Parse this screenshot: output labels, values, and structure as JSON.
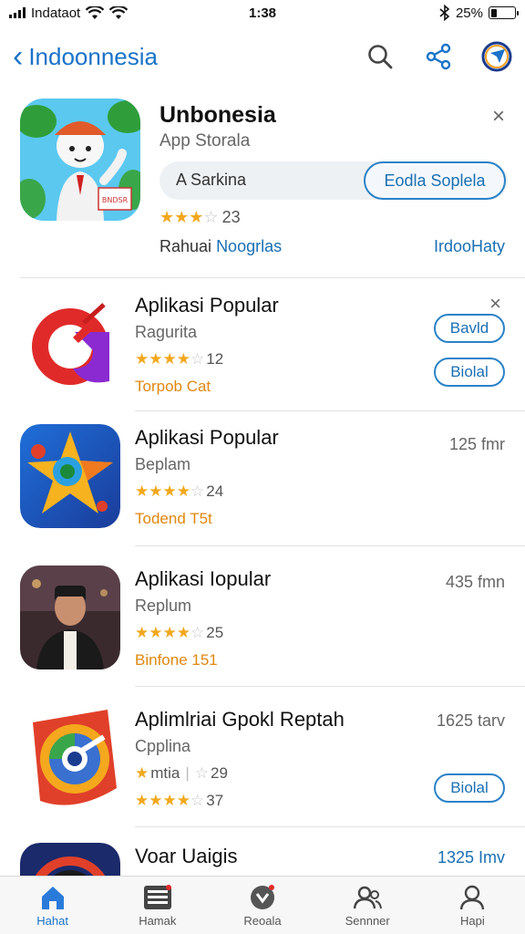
{
  "status_bar": {
    "carrier": "Indataot",
    "time": "1:38",
    "battery": "25%",
    "battery_level": 0.25
  },
  "nav": {
    "back_label": "Indoonnesia"
  },
  "featured": {
    "title": "Unbonesia",
    "subtitle": "App Storala",
    "search_placeholder": "A Sarkina",
    "action_button": "Eodla Soplela",
    "rating_count": "23",
    "rating_stars": 3,
    "left_link_prefix": "Rahuai",
    "left_link_highlight": "Noogrlas",
    "right_link": "IrdooHaty",
    "close_symbol": "×",
    "icon_badge_text": "BNDSR"
  },
  "apps": [
    {
      "name": "Aplikasi Popular",
      "developer": "Ragurita",
      "rating_count": "12",
      "rating_stars": 4,
      "tag": "Torpob Cat",
      "button_primary": "Bavld",
      "button_secondary": "Biolal",
      "close_symbol": "×"
    },
    {
      "name": "Aplikasi Popular",
      "developer": "Beplam",
      "rating_count": "24",
      "rating_stars": 4,
      "tag": "Todend T5t",
      "size": "125 fmr"
    },
    {
      "name": "Aplikasi Iopular",
      "developer": "Replum",
      "rating_count": "25",
      "rating_stars": 4,
      "tag": "Binfone 151",
      "size": "435 fmn"
    },
    {
      "name": "Aplimlriai Gpokl Reptah",
      "developer": "Cpplina",
      "rating_prefix": "mtia",
      "rating_count": "29",
      "rating_count2": "37",
      "rating_stars": 4,
      "size": "1625 tarv",
      "button_primary": "Biolal"
    },
    {
      "name": "Voar Uaigis",
      "size": "1325 Imv"
    }
  ],
  "tabs": [
    {
      "label": "Hahat",
      "icon": "home-icon",
      "active": true
    },
    {
      "label": "Hamak",
      "icon": "list-icon",
      "active": false
    },
    {
      "label": "Reoala",
      "icon": "pin-icon",
      "active": false
    },
    {
      "label": "Sennner",
      "icon": "people-icon",
      "active": false
    },
    {
      "label": "Hapi",
      "icon": "person-icon",
      "active": false
    }
  ],
  "colors": {
    "accent": "#1a73c9",
    "star": "#f2a81d",
    "tag": "#e0870f"
  }
}
